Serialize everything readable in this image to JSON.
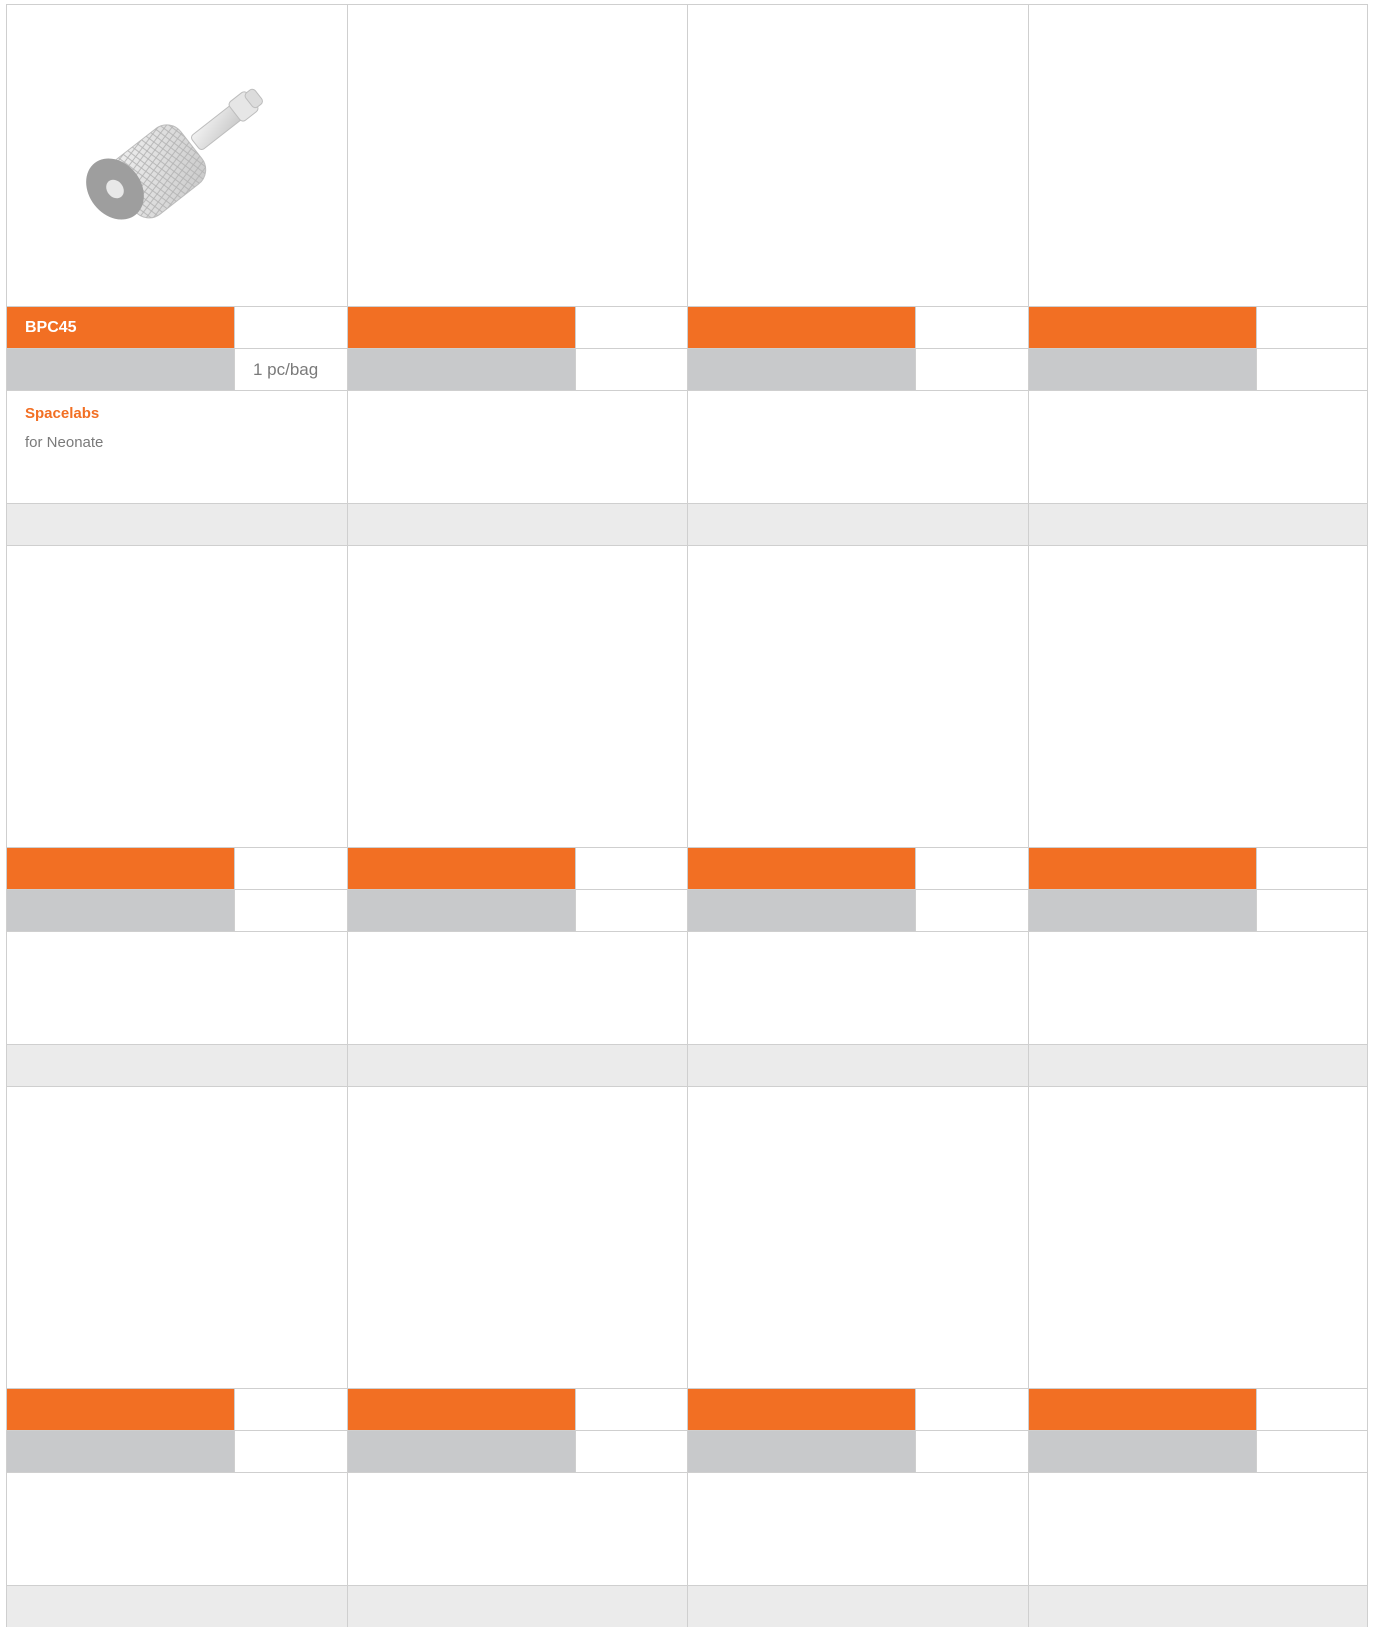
{
  "colors": {
    "accent": "#f26f23",
    "gray_band": "#c8c9cb",
    "light_band": "#ebebeb",
    "border": "#cfcfcf"
  },
  "products": [
    {
      "code": "BPC45",
      "packaging": "1 pc/bag",
      "brand": "Spacelabs",
      "note": "for Neonate",
      "image": "knurled-connector-icon"
    },
    {
      "code": "",
      "packaging": "",
      "brand": "",
      "note": ""
    },
    {
      "code": "",
      "packaging": "",
      "brand": "",
      "note": ""
    },
    {
      "code": "",
      "packaging": "",
      "brand": "",
      "note": ""
    },
    {
      "code": "",
      "packaging": "",
      "brand": "",
      "note": ""
    },
    {
      "code": "",
      "packaging": "",
      "brand": "",
      "note": ""
    },
    {
      "code": "",
      "packaging": "",
      "brand": "",
      "note": ""
    },
    {
      "code": "",
      "packaging": "",
      "brand": "",
      "note": ""
    },
    {
      "code": "",
      "packaging": "",
      "brand": "",
      "note": ""
    },
    {
      "code": "",
      "packaging": "",
      "brand": "",
      "note": ""
    },
    {
      "code": "",
      "packaging": "",
      "brand": "",
      "note": ""
    },
    {
      "code": "",
      "packaging": "",
      "brand": "",
      "note": ""
    }
  ]
}
